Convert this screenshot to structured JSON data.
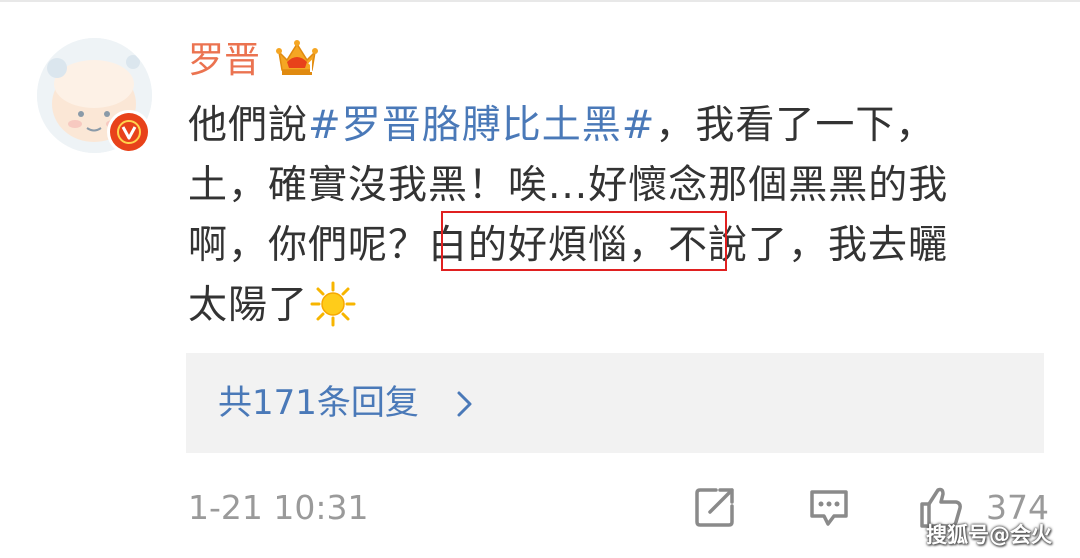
{
  "post": {
    "username": "罗晋",
    "verified_badge": "V",
    "content_lines": [
      {
        "before": "他們說",
        "hashtag": "#罗晋胳膊比土黑#",
        "after": "，我看了一下，"
      },
      {
        "text": "土，確實沒我黑！唉...好懷念那個黑黑的我"
      },
      {
        "before": "啊，你們呢？",
        "boxed": "白的好煩惱，",
        "after": "不說了，我去曬"
      },
      {
        "text": "太陽了"
      }
    ],
    "emoji": "sun-emoji",
    "reply_summary": "共171条回复",
    "timestamp": "1-21 10:31",
    "like_count": "374"
  },
  "watermark": "搜狐号@会火",
  "colors": {
    "username": "#eb7350",
    "hashtag": "#4a79b8",
    "text": "#333333",
    "meta": "#9a9a9a",
    "reply_bg": "#f2f2f2",
    "highlight_box": "#e02020"
  }
}
